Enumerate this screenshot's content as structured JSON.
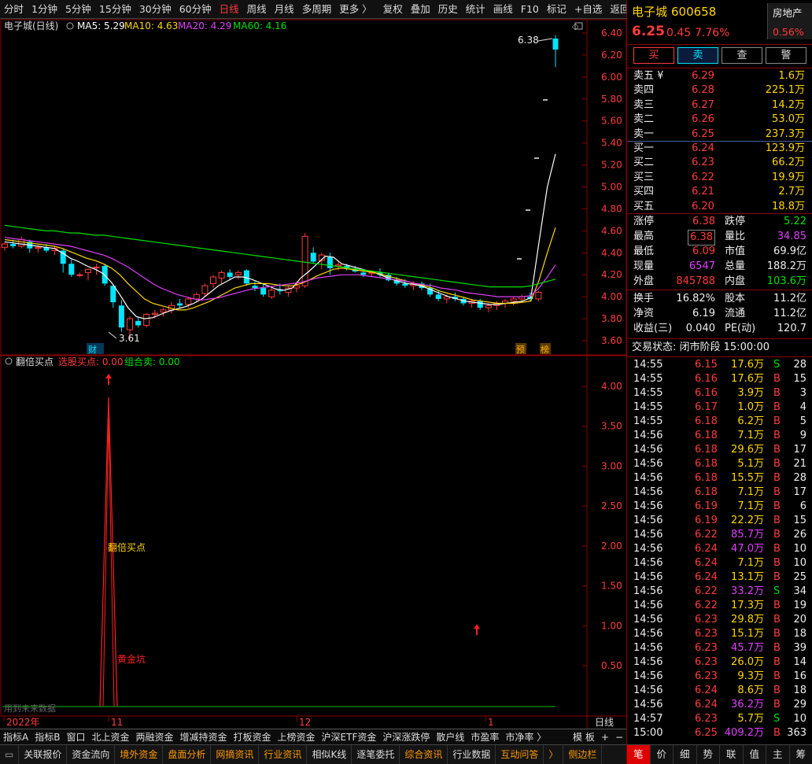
{
  "toolbar": {
    "periods": [
      {
        "label": "分时"
      },
      {
        "label": "1分钟"
      },
      {
        "label": "5分钟"
      },
      {
        "label": "15分钟"
      },
      {
        "label": "30分钟"
      },
      {
        "label": "60分钟"
      },
      {
        "label": "日线",
        "active": true
      },
      {
        "label": "周线"
      },
      {
        "label": "月线"
      },
      {
        "label": "多周期"
      },
      {
        "label": "更多 〉"
      }
    ],
    "tools": [
      {
        "label": "复权"
      },
      {
        "label": "叠加"
      },
      {
        "label": "历史"
      },
      {
        "label": "统计"
      },
      {
        "label": "画线"
      },
      {
        "label": "F10"
      },
      {
        "label": "标记"
      },
      {
        "label": "+自选"
      },
      {
        "label": "返回"
      }
    ]
  },
  "main_chart": {
    "title": "电子城(日线)",
    "ma": [
      {
        "label": "MA5: 5.29",
        "color": "#ffffff"
      },
      {
        "label": "MA10: 4.63",
        "color": "#ffd700"
      },
      {
        "label": "MA20: 4.29",
        "color": "#e040fb"
      },
      {
        "label": "MA60: 4.16",
        "color": "#00e000"
      }
    ],
    "y_ticks": [
      "6.40",
      "6.20",
      "6.00",
      "5.80",
      "5.60",
      "5.40",
      "5.20",
      "5.00",
      "4.80",
      "4.60",
      "4.40",
      "4.20",
      "4.00",
      "3.80",
      "3.60"
    ],
    "annotations": {
      "high_label": "6.38",
      "low_label": "3.61",
      "marker_cai": "财",
      "marker_yu": "预",
      "marker_bang": "榜"
    }
  },
  "indicator": {
    "name": "翻倍买点",
    "items": [
      {
        "label": "选股买点: 0.00",
        "color": "#ff3b3b"
      },
      {
        "label": "组合卖: 0.00",
        "color": "#00e000"
      }
    ],
    "y_ticks": [
      "4.00",
      "3.50",
      "3.00",
      "2.50",
      "2.00",
      "1.50",
      "1.00",
      "0.50"
    ],
    "label_buy": "翻倍买点",
    "label_gold": "黄金坑",
    "future_note": "用到未来数据"
  },
  "x_axis": {
    "labels": [
      "2022年",
      "11",
      "12",
      "1"
    ],
    "period": "日线"
  },
  "chart_data": {
    "type": "candlestick",
    "y_range": [
      3.55,
      6.45
    ],
    "ohlc": [
      [
        4.45,
        4.5,
        4.42,
        4.48
      ],
      [
        4.48,
        4.52,
        4.44,
        4.46
      ],
      [
        4.46,
        4.55,
        4.44,
        4.52
      ],
      [
        4.5,
        4.52,
        4.4,
        4.44
      ],
      [
        4.44,
        4.47,
        4.4,
        4.45
      ],
      [
        4.45,
        4.48,
        4.4,
        4.42
      ],
      [
        4.42,
        4.46,
        4.38,
        4.44
      ],
      [
        4.42,
        4.44,
        4.22,
        4.3
      ],
      [
        4.3,
        4.34,
        4.18,
        4.2
      ],
      [
        4.2,
        4.22,
        4.18,
        4.2
      ],
      [
        4.22,
        4.26,
        4.15,
        4.25
      ],
      [
        4.27,
        4.3,
        4.2,
        4.27
      ],
      [
        4.28,
        4.3,
        4.1,
        4.12
      ],
      [
        4.1,
        4.1,
        3.9,
        3.95
      ],
      [
        3.92,
        3.97,
        3.68,
        3.72
      ],
      [
        3.7,
        3.82,
        3.61,
        3.8
      ],
      [
        3.78,
        3.82,
        3.72,
        3.74
      ],
      [
        3.74,
        3.85,
        3.72,
        3.84
      ],
      [
        3.84,
        3.88,
        3.8,
        3.85
      ],
      [
        3.86,
        3.9,
        3.82,
        3.88
      ],
      [
        3.88,
        3.95,
        3.85,
        3.92
      ],
      [
        3.94,
        3.98,
        3.9,
        3.92
      ],
      [
        3.93,
        4.0,
        3.9,
        3.98
      ],
      [
        3.98,
        4.04,
        3.95,
        4.02
      ],
      [
        4.03,
        4.12,
        4.0,
        4.1
      ],
      [
        4.12,
        4.2,
        4.08,
        4.18
      ],
      [
        4.17,
        4.24,
        4.12,
        4.22
      ],
      [
        4.22,
        4.25,
        4.15,
        4.18
      ],
      [
        4.2,
        4.24,
        4.16,
        4.22
      ],
      [
        4.24,
        4.25,
        4.1,
        4.12
      ],
      [
        4.1,
        4.14,
        4.05,
        4.08
      ],
      [
        4.08,
        4.12,
        4.0,
        4.02
      ],
      [
        4.0,
        4.08,
        3.98,
        4.06
      ],
      [
        4.06,
        4.12,
        4.02,
        4.05
      ],
      [
        4.04,
        4.1,
        4.0,
        4.08
      ],
      [
        4.08,
        4.14,
        4.04,
        4.1
      ],
      [
        4.1,
        4.58,
        4.08,
        4.55
      ],
      [
        4.4,
        4.45,
        4.3,
        4.32
      ],
      [
        4.33,
        4.4,
        4.25,
        4.38
      ],
      [
        4.36,
        4.4,
        4.2,
        4.26
      ],
      [
        4.28,
        4.32,
        4.24,
        4.29
      ],
      [
        4.28,
        4.3,
        4.24,
        4.26
      ],
      [
        4.25,
        4.28,
        4.22,
        4.23
      ],
      [
        4.22,
        4.25,
        4.18,
        4.2
      ],
      [
        4.21,
        4.24,
        4.18,
        4.22
      ],
      [
        4.22,
        4.26,
        4.18,
        4.2
      ],
      [
        4.2,
        4.22,
        4.14,
        4.15
      ],
      [
        4.15,
        4.18,
        4.1,
        4.12
      ],
      [
        4.12,
        4.16,
        4.08,
        4.1
      ],
      [
        4.1,
        4.14,
        4.06,
        4.12
      ],
      [
        4.12,
        4.14,
        4.06,
        4.08
      ],
      [
        4.08,
        4.12,
        4.0,
        4.02
      ],
      [
        4.02,
        4.06,
        3.96,
        3.98
      ],
      [
        3.98,
        4.02,
        3.94,
        4.0
      ],
      [
        4.0,
        4.04,
        3.96,
        3.98
      ],
      [
        3.98,
        4.0,
        3.92,
        3.94
      ],
      [
        3.94,
        3.98,
        3.9,
        3.96
      ],
      [
        3.96,
        3.98,
        3.88,
        3.9
      ],
      [
        3.9,
        3.94,
        3.86,
        3.92
      ],
      [
        3.92,
        3.96,
        3.88,
        3.94
      ],
      [
        3.94,
        3.98,
        3.9,
        3.96
      ],
      [
        3.96,
        4.0,
        3.92,
        3.98
      ],
      [
        3.98,
        4.02,
        3.95,
        4.0
      ],
      [
        4.0,
        4.04,
        3.96,
        3.98
      ],
      [
        3.98,
        4.05,
        3.96,
        4.04
      ],
      [
        6.35,
        6.38,
        6.09,
        6.25
      ]
    ],
    "ma_series": [
      {
        "name": "MA5",
        "color": "#ffffff",
        "values": [
          4.5,
          4.49,
          4.48,
          4.47,
          4.46,
          4.45,
          4.44,
          4.4,
          4.35,
          4.32,
          4.28,
          4.25,
          4.21,
          4.13,
          4.02,
          3.9,
          3.82,
          3.8,
          3.81,
          3.84,
          3.87,
          3.89,
          3.91,
          3.94,
          3.98,
          4.04,
          4.1,
          4.14,
          4.18,
          4.18,
          4.16,
          4.13,
          4.1,
          4.07,
          4.06,
          4.08,
          4.17,
          4.23,
          4.3,
          4.37,
          4.36,
          4.3,
          4.28,
          4.26,
          4.24,
          4.22,
          4.19,
          4.16,
          4.14,
          4.12,
          4.11,
          4.09,
          4.06,
          4.03,
          4.0,
          3.98,
          3.96,
          3.95,
          3.94,
          3.93,
          3.93,
          3.94,
          3.95,
          3.96,
          3.99,
          4.5,
          5.0,
          5.3
        ]
      },
      {
        "name": "MA10",
        "color": "#ffd700",
        "values": [
          4.52,
          4.51,
          4.5,
          4.49,
          4.48,
          4.47,
          4.46,
          4.44,
          4.41,
          4.38,
          4.35,
          4.33,
          4.3,
          4.26,
          4.2,
          4.12,
          4.05,
          3.98,
          3.94,
          3.92,
          3.9,
          3.88,
          3.88,
          3.9,
          3.93,
          3.96,
          4.0,
          4.04,
          4.08,
          4.1,
          4.12,
          4.12,
          4.12,
          4.11,
          4.1,
          4.1,
          4.12,
          4.15,
          4.19,
          4.22,
          4.25,
          4.26,
          4.25,
          4.24,
          4.23,
          4.22,
          4.2,
          4.18,
          4.16,
          4.14,
          4.12,
          4.1,
          4.08,
          4.05,
          4.03,
          4.01,
          3.99,
          3.97,
          3.96,
          3.95,
          3.94,
          3.94,
          3.94,
          3.95,
          3.96,
          4.15,
          4.4,
          4.63
        ]
      },
      {
        "name": "MA20",
        "color": "#e040fb",
        "values": [
          4.54,
          4.53,
          4.52,
          4.51,
          4.5,
          4.49,
          4.48,
          4.47,
          4.46,
          4.44,
          4.42,
          4.4,
          4.38,
          4.35,
          4.31,
          4.27,
          4.22,
          4.17,
          4.12,
          4.08,
          4.05,
          4.02,
          4.0,
          3.98,
          3.97,
          3.98,
          3.99,
          4.01,
          4.03,
          4.05,
          4.07,
          4.08,
          4.09,
          4.1,
          4.11,
          4.12,
          4.13,
          4.15,
          4.17,
          4.18,
          4.19,
          4.2,
          4.2,
          4.2,
          4.19,
          4.18,
          4.17,
          4.16,
          4.15,
          4.14,
          4.12,
          4.11,
          4.1,
          4.08,
          4.07,
          4.06,
          4.04,
          4.03,
          4.02,
          4.01,
          4.0,
          4.0,
          4.0,
          4.0,
          4.01,
          4.08,
          4.18,
          4.29
        ]
      },
      {
        "name": "MA60",
        "color": "#00e000",
        "values": [
          4.65,
          4.64,
          4.63,
          4.62,
          4.61,
          4.6,
          4.6,
          4.59,
          4.58,
          4.58,
          4.57,
          4.56,
          4.56,
          4.55,
          4.54,
          4.53,
          4.52,
          4.51,
          4.5,
          4.49,
          4.48,
          4.47,
          4.46,
          4.45,
          4.44,
          4.43,
          4.42,
          4.41,
          4.4,
          4.39,
          4.38,
          4.37,
          4.36,
          4.35,
          4.34,
          4.33,
          4.32,
          4.31,
          4.3,
          4.29,
          4.28,
          4.27,
          4.26,
          4.25,
          4.24,
          4.23,
          4.22,
          4.21,
          4.2,
          4.19,
          4.18,
          4.17,
          4.16,
          4.15,
          4.14,
          4.13,
          4.12,
          4.11,
          4.1,
          4.09,
          4.09,
          4.09,
          4.09,
          4.09,
          4.1,
          4.12,
          4.14,
          4.16
        ]
      }
    ],
    "signal_spike": {
      "index": 8,
      "value": 4.0
    },
    "signal_arrow2": {
      "index": 62,
      "value": 1.0
    },
    "indicator_range": [
      0,
      4.3
    ]
  },
  "tabs": [
    {
      "label": "指标A"
    },
    {
      "label": "指标B"
    },
    {
      "label": "窗口"
    },
    {
      "label": "北上资金"
    },
    {
      "label": "两融资金"
    },
    {
      "label": "增减持资金"
    },
    {
      "label": "打板资金"
    },
    {
      "label": "上榜资金"
    },
    {
      "label": "沪深ETF资金"
    },
    {
      "label": "沪深涨跌停"
    },
    {
      "label": "散户线"
    },
    {
      "label": "市盈率"
    },
    {
      "label": "市净率 〉"
    },
    {
      "label": "模 板"
    },
    {
      "label": "+"
    },
    {
      "label": "−"
    }
  ],
  "bottom_tabs": [
    {
      "label": "关联报价"
    },
    {
      "label": "资金流向"
    },
    {
      "label": "境外资金",
      "orange": true
    },
    {
      "label": "盘面分析",
      "orange": true
    },
    {
      "label": "网摘资讯",
      "orange": true
    },
    {
      "label": "行业资讯",
      "orange": true
    },
    {
      "label": "相似K线"
    },
    {
      "label": "逐笔委托"
    },
    {
      "label": "综合资讯",
      "orange": true
    },
    {
      "label": "行业数据"
    },
    {
      "label": "互动问答",
      "orange": true
    },
    {
      "label": "〉",
      "orange": true
    },
    {
      "label": "侧边栏",
      "orange": true
    }
  ],
  "stock": {
    "name": "电子城",
    "code": "600658",
    "sector": "房地产",
    "sector_change": "0.56%",
    "price": "6.25",
    "change": "0.45",
    "change_pct": "7.76%"
  },
  "actions": [
    {
      "label": "买",
      "color": "#ff3b3b"
    },
    {
      "label": "卖",
      "color": "#00e5ff"
    },
    {
      "label": "查",
      "color": "#ddd"
    },
    {
      "label": "警",
      "color": "#ddd"
    }
  ],
  "order_book": {
    "sell": [
      {
        "label": "卖五 ¥",
        "price": "6.29",
        "vol": "1.6万"
      },
      {
        "label": "卖四",
        "price": "6.28",
        "vol": "225.1万"
      },
      {
        "label": "卖三",
        "price": "6.27",
        "vol": "14.2万"
      },
      {
        "label": "卖二",
        "price": "6.26",
        "vol": "53.0万"
      },
      {
        "label": "卖一",
        "price": "6.25",
        "vol": "237.3万"
      }
    ],
    "buy": [
      {
        "label": "买一",
        "price": "6.24",
        "vol": "123.9万"
      },
      {
        "label": "买二",
        "price": "6.23",
        "vol": "66.2万"
      },
      {
        "label": "买三",
        "price": "6.22",
        "vol": "19.9万"
      },
      {
        "label": "买四",
        "price": "6.21",
        "vol": "2.7万"
      },
      {
        "label": "买五",
        "price": "6.20",
        "vol": "18.8万"
      }
    ]
  },
  "stats": [
    {
      "l1": "涨停",
      "v1": "6.38",
      "c1": "#ff3b3b",
      "l2": "跌停",
      "v2": "5.22",
      "c2": "#00e000"
    },
    {
      "l1": "最高",
      "v1": "6.38",
      "c1": "#ff3b3b",
      "l2": "量比",
      "v2": "34.85",
      "c2": "#e040fb",
      "box": true
    },
    {
      "l1": "最低",
      "v1": "6.09",
      "c1": "#ff3b3b",
      "l2": "市值",
      "v2": "69.9亿",
      "c2": "#eee"
    },
    {
      "l1": "现量",
      "v1": "6547",
      "c1": "#e040fb",
      "l2": "总量",
      "v2": "188.2万",
      "c2": "#eee"
    },
    {
      "l1": "外盘",
      "v1": "845788",
      "c1": "#ff3b3b",
      "l2": "内盘",
      "v2": "103.6万",
      "c2": "#00e000"
    }
  ],
  "stats2": [
    {
      "l1": "换手",
      "v1": "16.82%",
      "l2": "股本",
      "v2": "11.2亿"
    },
    {
      "l1": "净资",
      "v1": "6.19",
      "l2": "流通",
      "v2": "11.2亿"
    },
    {
      "l1": "收益(三)",
      "v1": "0.040",
      "l2": "PE(动)",
      "v2": "120.7"
    }
  ],
  "trade_status": "交易状态: 闭市阶段 15:00:00",
  "ticks": [
    {
      "time": "14:55",
      "price": "6.15",
      "vol": "17.6万",
      "side": "S",
      "n": "28"
    },
    {
      "time": "14:55",
      "price": "6.16",
      "vol": "17.6万",
      "side": "B",
      "n": "15"
    },
    {
      "time": "14:55",
      "price": "6.16",
      "vol": "3.9万",
      "side": "B",
      "n": "3"
    },
    {
      "time": "14:55",
      "price": "6.17",
      "vol": "1.0万",
      "side": "B",
      "n": "4"
    },
    {
      "time": "14:55",
      "price": "6.18",
      "vol": "6.2万",
      "side": "B",
      "n": "5"
    },
    {
      "time": "14:56",
      "price": "6.18",
      "vol": "7.1万",
      "side": "B",
      "n": "9"
    },
    {
      "time": "14:56",
      "price": "6.18",
      "vol": "29.6万",
      "side": "B",
      "n": "17"
    },
    {
      "time": "14:56",
      "price": "6.18",
      "vol": "5.1万",
      "side": "B",
      "n": "21"
    },
    {
      "time": "14:56",
      "price": "6.18",
      "vol": "15.5万",
      "side": "B",
      "n": "28"
    },
    {
      "time": "14:56",
      "price": "6.18",
      "vol": "7.1万",
      "side": "B",
      "n": "17"
    },
    {
      "time": "14:56",
      "price": "6.19",
      "vol": "7.1万",
      "side": "B",
      "n": "6"
    },
    {
      "time": "14:56",
      "price": "6.19",
      "vol": "22.2万",
      "side": "B",
      "n": "15"
    },
    {
      "time": "14:56",
      "price": "6.22",
      "vol": "85.7万",
      "side": "B",
      "n": "26",
      "big": true
    },
    {
      "time": "14:56",
      "price": "6.24",
      "vol": "47.0万",
      "side": "B",
      "n": "10",
      "big": true
    },
    {
      "time": "14:56",
      "price": "6.24",
      "vol": "7.1万",
      "side": "B",
      "n": "10"
    },
    {
      "time": "14:56",
      "price": "6.24",
      "vol": "13.1万",
      "side": "B",
      "n": "25"
    },
    {
      "time": "14:56",
      "price": "6.22",
      "vol": "33.2万",
      "side": "S",
      "n": "34",
      "big": true
    },
    {
      "time": "14:56",
      "price": "6.22",
      "vol": "17.3万",
      "side": "B",
      "n": "19"
    },
    {
      "time": "14:56",
      "price": "6.23",
      "vol": "29.8万",
      "side": "B",
      "n": "20"
    },
    {
      "time": "14:56",
      "price": "6.23",
      "vol": "15.1万",
      "side": "B",
      "n": "18"
    },
    {
      "time": "14:56",
      "price": "6.23",
      "vol": "45.7万",
      "side": "B",
      "n": "39",
      "big": true
    },
    {
      "time": "14:56",
      "price": "6.23",
      "vol": "26.0万",
      "side": "B",
      "n": "14"
    },
    {
      "time": "14:56",
      "price": "6.23",
      "vol": "9.3万",
      "side": "B",
      "n": "16"
    },
    {
      "time": "14:56",
      "price": "6.24",
      "vol": "8.6万",
      "side": "B",
      "n": "18"
    },
    {
      "time": "14:56",
      "price": "6.24",
      "vol": "36.2万",
      "side": "B",
      "n": "29",
      "big": true
    },
    {
      "time": "14:57",
      "price": "6.23",
      "vol": "5.7万",
      "side": "S",
      "n": "10"
    },
    {
      "time": "15:00",
      "price": "6.25",
      "vol": "409.2万",
      "side": "B",
      "n": "363",
      "big": true
    }
  ],
  "rp_bottom": [
    {
      "label": "笔",
      "sel": true
    },
    {
      "label": "价"
    },
    {
      "label": "细"
    },
    {
      "label": "势"
    },
    {
      "label": "联"
    },
    {
      "label": "值"
    },
    {
      "label": "主"
    },
    {
      "label": "筹"
    }
  ],
  "colors": {
    "up": "#ff3b3b",
    "down": "#00e5ff",
    "grid": "#5a0000",
    "border": "#8b0000"
  }
}
